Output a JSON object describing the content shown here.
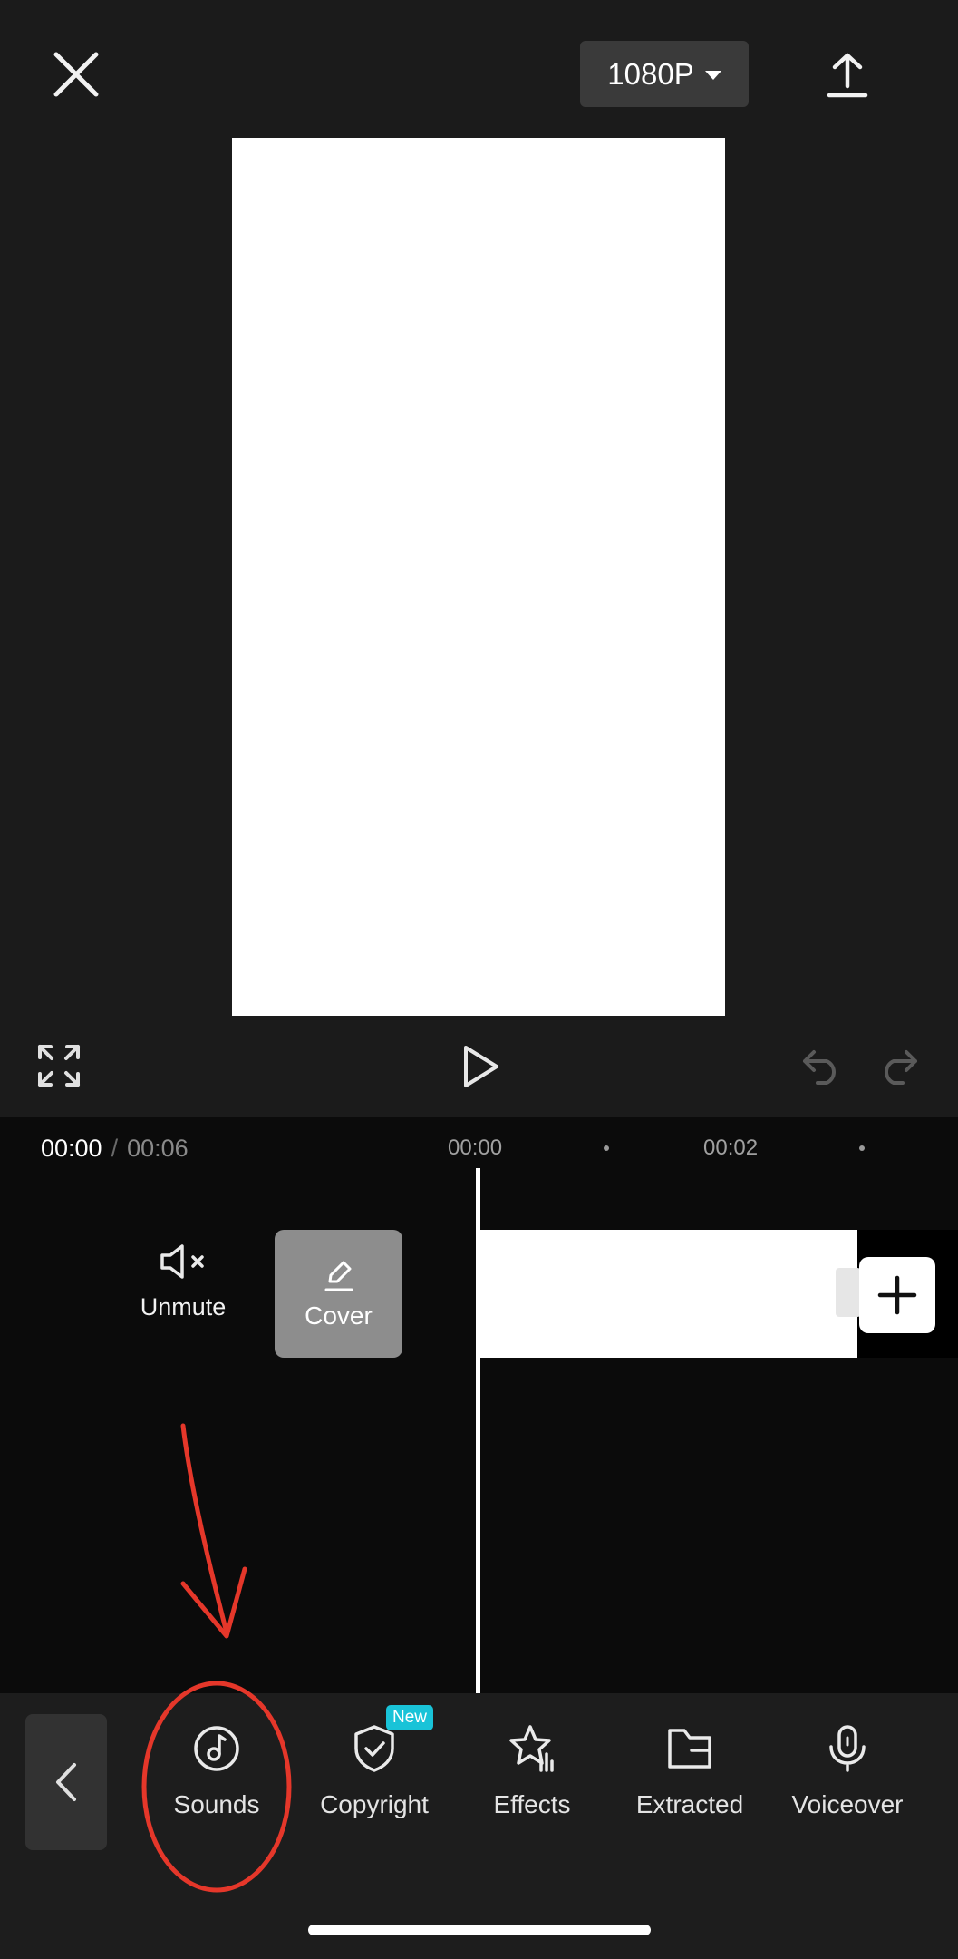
{
  "topbar": {
    "resolution": "1080P"
  },
  "timeline": {
    "current_time": "00:00",
    "separator": "/",
    "total_time": "00:06",
    "ruler": [
      "00:00",
      "00:02"
    ],
    "unmute_label": "Unmute",
    "cover_label": "Cover"
  },
  "toolbar": {
    "items": [
      {
        "label": "Sounds",
        "icon": "music-note-circle-icon"
      },
      {
        "label": "Copyright",
        "icon": "shield-check-icon",
        "badge": "New"
      },
      {
        "label": "Effects",
        "icon": "star-effects-icon"
      },
      {
        "label": "Extracted",
        "icon": "folder-icon"
      },
      {
        "label": "Voiceover",
        "icon": "microphone-icon"
      }
    ]
  },
  "colors": {
    "badge": "#19c3d8",
    "annotation": "#e5372a",
    "background": "#1b1b1b"
  }
}
